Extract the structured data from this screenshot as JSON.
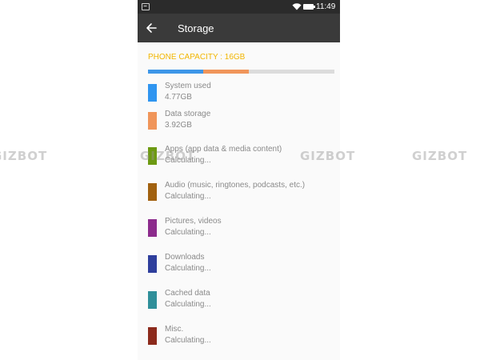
{
  "status_bar": {
    "time": "11:49"
  },
  "toolbar": {
    "title": "Storage"
  },
  "capacity": {
    "label": "PHONE CAPACITY : 16GB",
    "total_gb": 16
  },
  "usage_bar": [
    {
      "name": "System used",
      "gb": 4.77,
      "color": "#3d96e8"
    },
    {
      "name": "Data storage",
      "gb": 3.92,
      "color": "#f0955a"
    }
  ],
  "categories": [
    {
      "name": "System used",
      "size": "4.77GB",
      "color": "#2f95f0"
    },
    {
      "name": "Data storage",
      "size": "3.92GB",
      "color": "#f0955a"
    },
    {
      "name": "Apps (app data & media content)",
      "size": "Calculating...",
      "color": "#6d9a12"
    },
    {
      "name": "Audio (music, ringtones, podcasts, etc.)",
      "size": "Calculating...",
      "color": "#a1610f"
    },
    {
      "name": "Pictures, videos",
      "size": "Calculating...",
      "color": "#8c2b8c"
    },
    {
      "name": "Downloads",
      "size": "Calculating...",
      "color": "#2e3e9c"
    },
    {
      "name": "Cached data",
      "size": "Calculating...",
      "color": "#2f8f9a"
    },
    {
      "name": "Misc.",
      "size": "Calculating...",
      "color": "#8c2a1c"
    }
  ],
  "watermark": [
    "GIZBOT",
    "GIZBOT",
    "GIZBOT",
    "GIZBOT"
  ],
  "colors": {
    "status_bar": "#2b2b2b",
    "toolbar": "#3a3a3a",
    "capacity_accent": "#f2b600",
    "bar_track": "#dcdcdc",
    "text_gray": "#8a8a8a"
  }
}
